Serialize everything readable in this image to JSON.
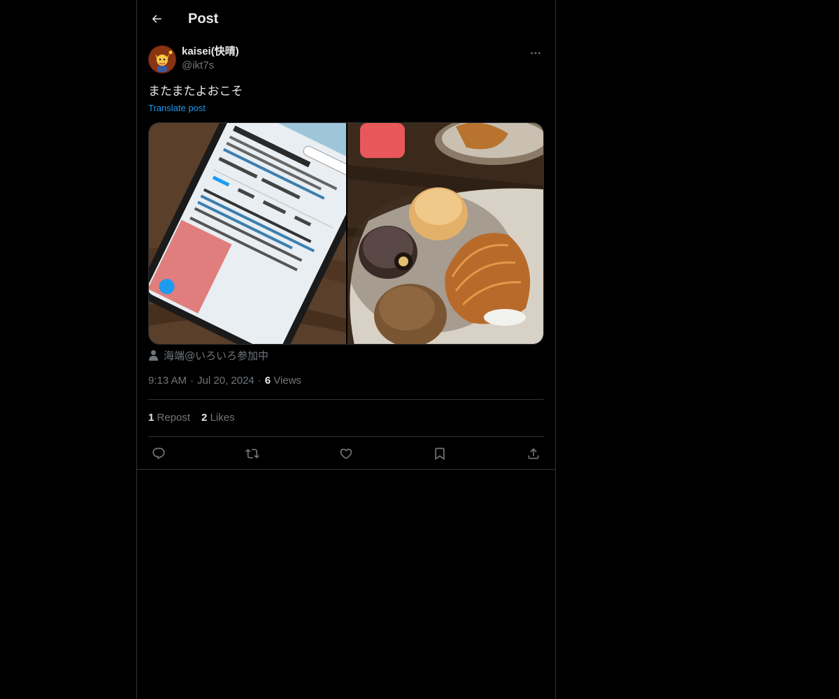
{
  "header": {
    "title": "Post",
    "back_icon": "arrow-left-icon"
  },
  "post": {
    "author": {
      "display_name": "kaisei(快晴)",
      "handle": "@ikt7s"
    },
    "text": "またまたよおこそ",
    "translate_label": "Translate post",
    "media": [
      {
        "description_icon": "phone-screenshot-image"
      },
      {
        "description_icon": "pastries-photo-image"
      }
    ],
    "tagged_user": "海端@いろいろ参加中",
    "time": "9:13 AM",
    "separator": "·",
    "date": "Jul 20, 2024",
    "views_count": "6",
    "views_label": "Views",
    "reposts_count": "1",
    "reposts_label": "Repost",
    "likes_count": "2",
    "likes_label": "Likes"
  },
  "actions": [
    {
      "name": "reply",
      "icon": "reply-icon"
    },
    {
      "name": "repost",
      "icon": "repost-icon"
    },
    {
      "name": "like",
      "icon": "heart-icon"
    },
    {
      "name": "bookmark",
      "icon": "bookmark-icon"
    },
    {
      "name": "share",
      "icon": "share-icon"
    }
  ],
  "colors": {
    "background": "#000000",
    "text": "#e7e9ea",
    "secondary_text": "#71767b",
    "link": "#1d9bf0",
    "border": "#2f3336"
  }
}
